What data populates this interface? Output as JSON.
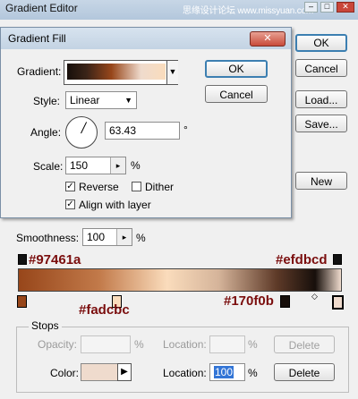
{
  "editor": {
    "title": "Gradient Editor",
    "watermark": "思缘设计论坛 www.missyuan.com",
    "ok_label": "OK",
    "cancel_label": "Cancel",
    "load_label": "Load...",
    "save_label": "Save...",
    "new_label": "New",
    "smoothness_label": "Smoothness:",
    "smoothness_value": "100",
    "smoothness_unit": "%",
    "annotations": {
      "top_left": "#97461a",
      "top_right": "#efdbcd",
      "bottom_left": "#fadcbc",
      "bottom_right": "#170f0b"
    },
    "stops": {
      "group_label": "Stops",
      "opacity_label": "Opacity:",
      "opacity_unit": "%",
      "location_label_1": "Location:",
      "location_unit_1": "%",
      "delete_label_1": "Delete",
      "color_label": "Color:",
      "color_swatch": "#efdbcd",
      "location_label_2": "Location:",
      "location_value": "100",
      "location_unit_2": "%",
      "delete_label_2": "Delete"
    }
  },
  "gradient_fill": {
    "title": "Gradient Fill",
    "gradient_label": "Gradient:",
    "style_label": "Style:",
    "style_value": "Linear",
    "angle_label": "Angle:",
    "angle_value": "63.43",
    "angle_unit": "°",
    "scale_label": "Scale:",
    "scale_value": "150",
    "scale_unit": "%",
    "reverse_label": "Reverse",
    "reverse_checked": true,
    "dither_label": "Dither",
    "dither_checked": false,
    "align_label": "Align with layer",
    "align_checked": true,
    "ok_label": "OK",
    "cancel_label": "Cancel"
  },
  "colors": {
    "accent_border": "#3c7fb1",
    "annotation_text": "#7a0d0d"
  }
}
